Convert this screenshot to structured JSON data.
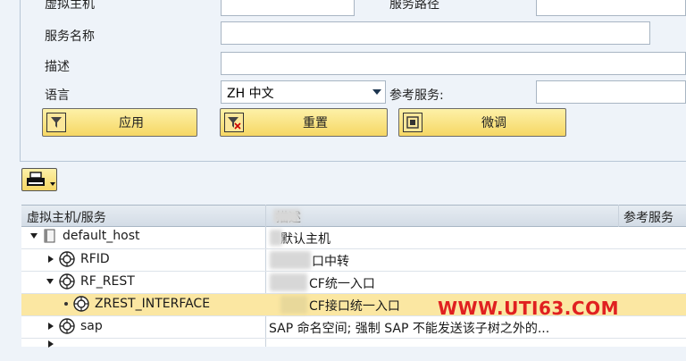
{
  "form": {
    "virtual_host_label": "虚拟主机",
    "service_path_label": "服务路径",
    "service_name_label": "服务名称",
    "description_label": "描述",
    "language_label": "语言",
    "language_value": "ZH 中文",
    "ref_service_label": "参考服务:",
    "buttons": {
      "apply": "应用",
      "reset": "重置",
      "finetune": "微调"
    }
  },
  "table": {
    "col_host_service": "虚拟主机/服务",
    "col_description": "描述",
    "col_ref_service": "参考服务",
    "rows": [
      {
        "name": "default_host",
        "desc": "默认主机"
      },
      {
        "name": "RFID",
        "desc": "口中转"
      },
      {
        "name": "RF_REST",
        "desc": "CF统一入口"
      },
      {
        "name": "ZREST_INTERFACE",
        "desc": "CF接口统一入口"
      },
      {
        "name": "sap",
        "desc": "SAP 命名空间; 强制 SAP 不能发送该子树之外的..."
      }
    ]
  },
  "watermark": "WWW.UTI63.COM",
  "colors": {
    "button_yellow": "#f6d764",
    "selected_row": "#fbe7a2",
    "watermark": "#e02020"
  }
}
